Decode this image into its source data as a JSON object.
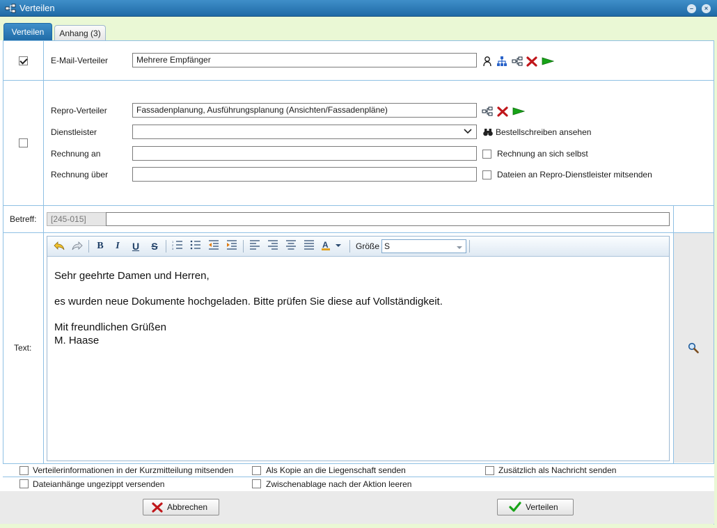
{
  "window": {
    "title": "Verteilen"
  },
  "tabs": [
    {
      "label": "Verteilen"
    },
    {
      "label": "Anhang (3)"
    }
  ],
  "email": {
    "label": "E-Mail-Verteiler",
    "value": "Mehrere Empfänger",
    "checked": true
  },
  "repro": {
    "label": "Repro-Verteiler",
    "value": "Fassadenplanung, Ausführungsplanung (Ansichten/Fassadenpläne)",
    "dienstleister_label": "Dienstleister",
    "dienstleister_value": "",
    "bestell_label": "Bestellschreiben ansehen",
    "rechnung_an_label": "Rechnung an",
    "rechnung_an_value": "",
    "rechnung_selbst_label": "Rechnung an sich selbst",
    "rechnung_ueber_label": "Rechnung über",
    "rechnung_ueber_value": "",
    "dateien_label": "Dateien an Repro-Dienstleister mitsenden"
  },
  "betreff": {
    "label": "Betreff:",
    "prefix": "[245-015]",
    "value": ""
  },
  "text": {
    "label": "Text:",
    "size_label": "Größe",
    "size_value": "S",
    "lines": [
      "Sehr geehrte Damen und Herren,",
      "es wurden neue Dokumente hochgeladen. Bitte prüfen Sie diese auf Vollständigkeit.",
      "Mit freundlichen Grüßen",
      "M. Haase"
    ]
  },
  "options": {
    "info_kurzmitteilung": "Verteilerinformationen in der Kurzmitteilung mitsenden",
    "kopie_liegenschaft": "Als Kopie an die Liegenschaft senden",
    "zusaetzlich_nachricht": "Zusätzlich als Nachricht senden",
    "dateianhaenge_ungezippt": "Dateianhänge ungezippt versenden",
    "zwischenablage_leeren": "Zwischenablage nach der Aktion leeren"
  },
  "buttons": {
    "cancel": "Abbrechen",
    "submit": "Verteilen"
  },
  "colors": {
    "accent": "#1f6aa6",
    "delete": "#c0161a",
    "go": "#17a317",
    "tab_bg": "#eaf8d5"
  }
}
